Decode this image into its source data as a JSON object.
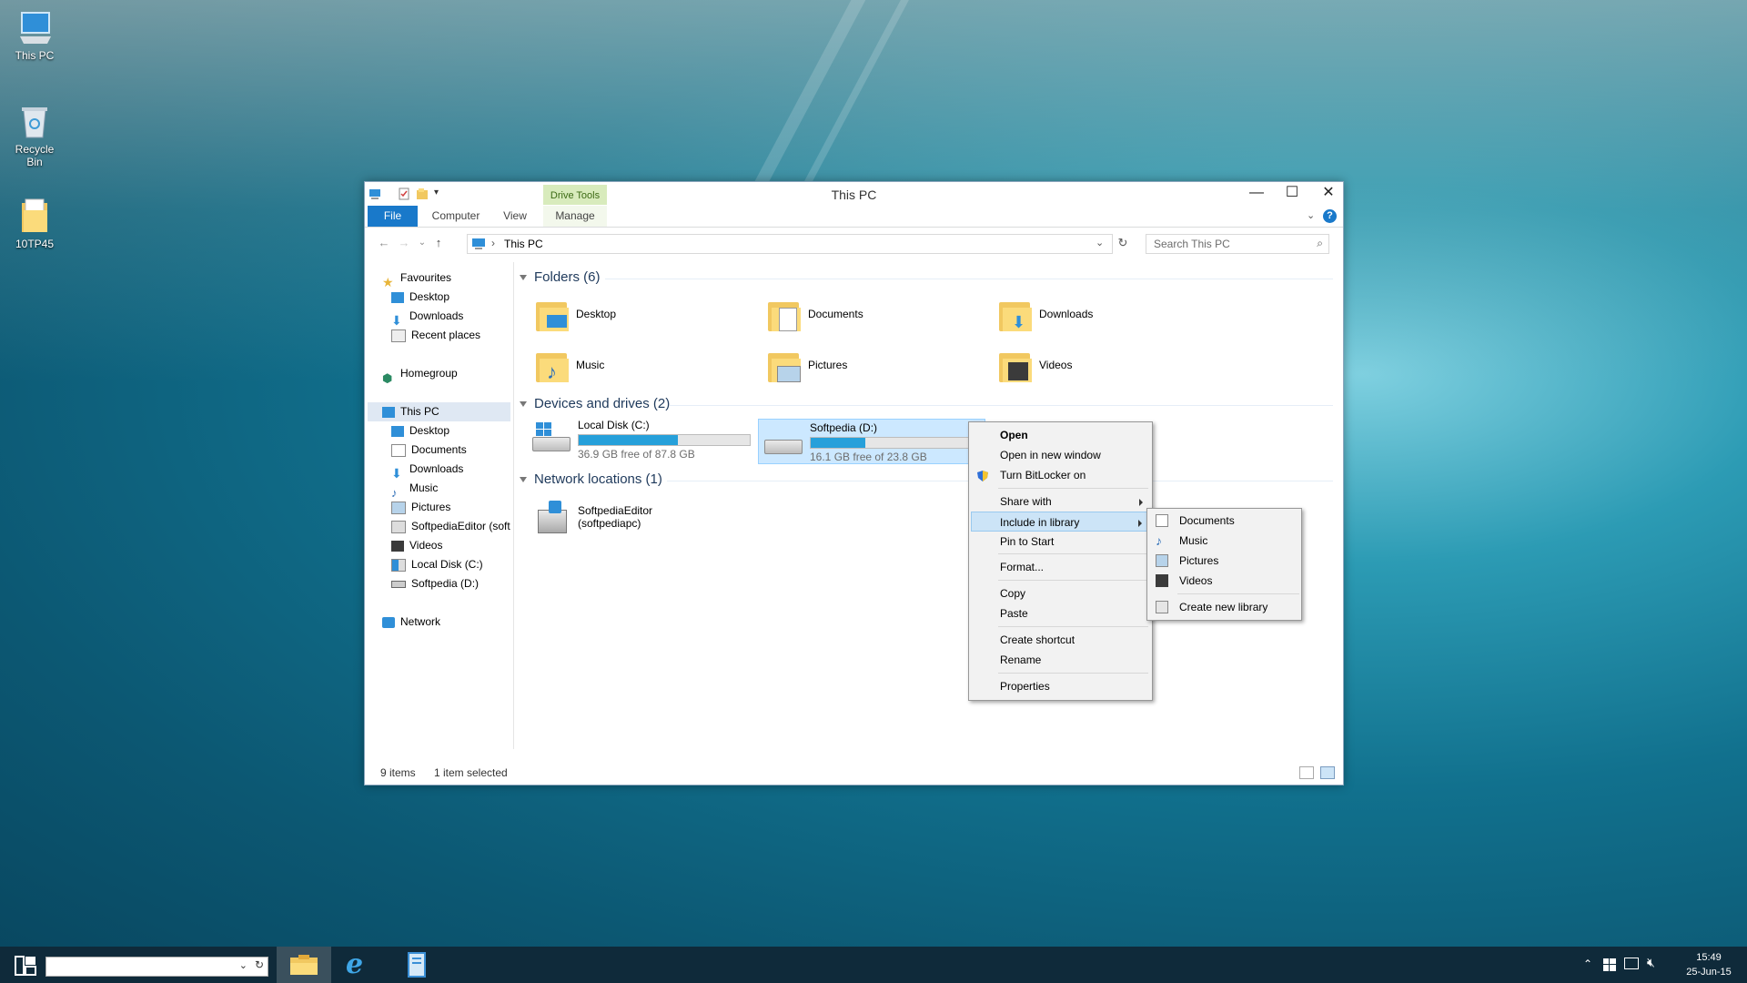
{
  "desktop": {
    "icons": [
      {
        "label": "This PC",
        "icon": "computer-icon"
      },
      {
        "label": "Recycle Bin",
        "icon": "recycle-bin-icon"
      },
      {
        "label": "10TP45",
        "icon": "folder-icon"
      }
    ]
  },
  "window": {
    "title": "This PC",
    "context_tab_label": "Drive Tools",
    "controls": {
      "minimize": "—",
      "maximize": "☐",
      "close": "✕"
    },
    "ribbon_tabs": [
      "File",
      "Computer",
      "View",
      "Manage"
    ],
    "address": {
      "breadcrumb": "This PC"
    },
    "search": {
      "placeholder": "Search This PC"
    }
  },
  "nav_pane": {
    "favourites_label": "Favourites",
    "favourites": [
      "Desktop",
      "Downloads",
      "Recent places"
    ],
    "homegroup": "Homegroup",
    "this_pc": "This PC",
    "this_pc_items": [
      "Desktop",
      "Documents",
      "Downloads",
      "Music",
      "Pictures",
      "SoftpediaEditor (softpediapc)",
      "Videos",
      "Local Disk (C:)",
      "Softpedia (D:)"
    ],
    "network": "Network"
  },
  "content": {
    "folders_header": "Folders (6)",
    "folders": [
      "Desktop",
      "Documents",
      "Downloads",
      "Music",
      "Pictures",
      "Videos"
    ],
    "devices_header": "Devices and drives (2)",
    "drives": [
      {
        "name": "Local Disk (C:)",
        "free_text": "36.9 GB free of 87.8 GB",
        "used_fraction": 0.58,
        "selected": false
      },
      {
        "name": "Softpedia (D:)",
        "free_text": "16.1 GB free of 23.8 GB",
        "used_fraction": 0.32,
        "selected": true
      }
    ],
    "network_header": "Network locations (1)",
    "network_locations": [
      "SoftpediaEditor (softpediapc)"
    ]
  },
  "status_bar": {
    "item_count": "9 items",
    "selection": "1 item selected"
  },
  "context_menu": {
    "items": {
      "open": "Open",
      "open_new_window": "Open in new window",
      "bitlocker": "Turn BitLocker on",
      "share_with": "Share with",
      "include_in_library": "Include in library",
      "pin_to_start": "Pin to Start",
      "format": "Format...",
      "copy": "Copy",
      "paste": "Paste",
      "create_shortcut": "Create shortcut",
      "rename": "Rename",
      "properties": "Properties"
    },
    "submenu": {
      "items": [
        "Documents",
        "Music",
        "Pictures",
        "Videos"
      ],
      "create_new": "Create new library"
    }
  },
  "taskbar": {
    "time": "15:49",
    "date": "25-Jun-15"
  },
  "colors": {
    "accent": "#1979ca",
    "selection": "#cce4f7",
    "drive_bar": "#26a0da",
    "taskbar": "#0f2a3a"
  }
}
